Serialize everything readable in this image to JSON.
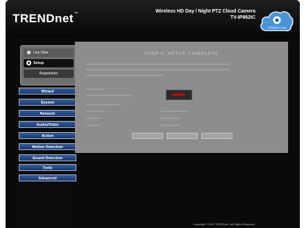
{
  "header": {
    "logo": "TRENDnet",
    "product_title": "Wireless HD Day / Night PTZ Cloud Camera",
    "model": "TV-IP862IC",
    "cloud_badge": "TRENDnet Cloud"
  },
  "modes": {
    "live_view": "Live View",
    "setup": "Setup",
    "registration": "Registration",
    "selected": "Setup"
  },
  "menu": [
    "Wizard",
    "System",
    "Network",
    "Audio/Video",
    "Action",
    "Motion Detection",
    "Sound Detection",
    "Tools",
    "Advanced"
  ],
  "content": {
    "title": "STEP 5. SETUP COMPLETE",
    "buttons": [
      "",
      "",
      ""
    ]
  },
  "footer": {
    "copyright": "Copyright © 2012 TRENDnet. All Rights Reserved."
  },
  "colors": {
    "background": "#0a0a0a",
    "menu_button": "#1f4a8a",
    "content_overlay": "#8d8d8d",
    "indicator_red": "#a11414"
  }
}
